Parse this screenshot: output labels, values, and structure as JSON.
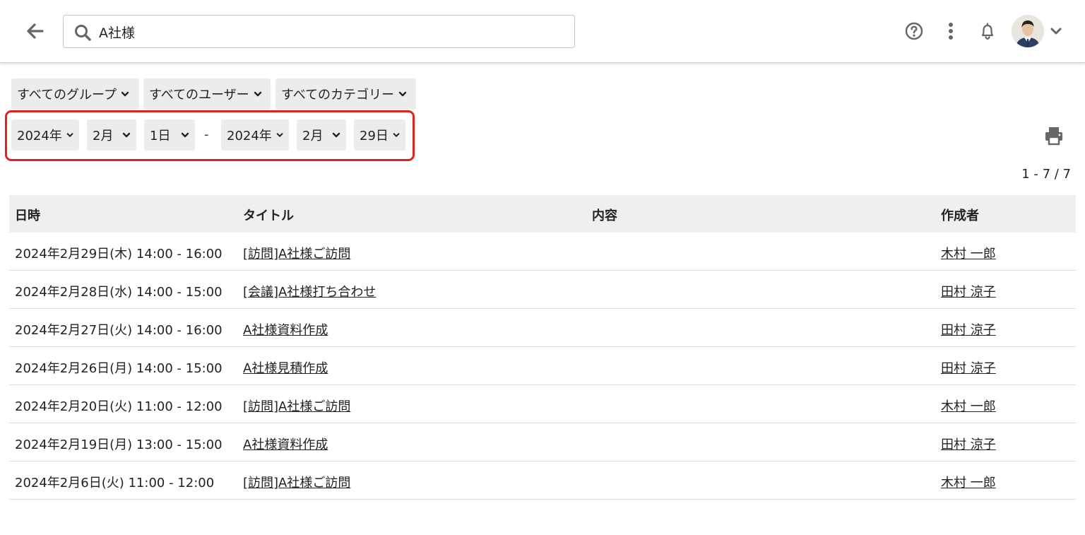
{
  "header": {
    "search_value": "A社様"
  },
  "filters": {
    "group": "すべてのグループ",
    "user": "すべてのユーザー",
    "category": "すべてのカテゴリー"
  },
  "date_range": {
    "from_year": "2024年",
    "from_month": "2月",
    "from_day": "1日",
    "separator": "-",
    "to_year": "2024年",
    "to_month": "2月",
    "to_day": "29日",
    "highlight_color": "#e32020"
  },
  "result_count": "1 - 7 / 7",
  "table": {
    "headers": [
      "日時",
      "タイトル",
      "内容",
      "作成者"
    ],
    "rows": [
      {
        "datetime": "2024年2月29日(木) 14:00 - 16:00",
        "title": "[訪問]A社様ご訪問",
        "content": "",
        "author": "木村 一郎"
      },
      {
        "datetime": "2024年2月28日(水) 14:00 - 15:00",
        "title": "[会議]A社様打ち合わせ",
        "content": "",
        "author": "田村 涼子"
      },
      {
        "datetime": "2024年2月27日(火) 14:00 - 16:00",
        "title": "A社様資料作成",
        "content": "",
        "author": "田村 涼子"
      },
      {
        "datetime": "2024年2月26日(月) 14:00 - 15:00",
        "title": "A社様見積作成",
        "content": "",
        "author": "田村 涼子"
      },
      {
        "datetime": "2024年2月20日(火) 11:00 - 12:00",
        "title": "[訪問]A社様ご訪問",
        "content": "",
        "author": "木村 一郎"
      },
      {
        "datetime": "2024年2月19日(月) 13:00 - 15:00",
        "title": "A社様資料作成",
        "content": "",
        "author": "田村 涼子"
      },
      {
        "datetime": "2024年2月6日(火) 11:00 - 12:00",
        "title": "[訪問]A社様ご訪問",
        "content": "",
        "author": "木村 一郎"
      }
    ]
  },
  "icons": {
    "back": "arrow-left-icon",
    "search": "search-icon",
    "help": "help-circle-icon",
    "more": "more-vertical-icon",
    "notifications": "bell-icon",
    "account_menu": "chevron-down-icon",
    "print": "printer-icon"
  }
}
